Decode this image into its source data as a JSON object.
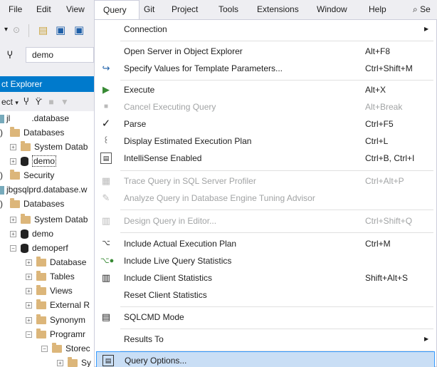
{
  "menubar": {
    "items": [
      "File",
      "Edit",
      "View",
      "Query",
      "Git",
      "Project",
      "Tools",
      "Extensions",
      "Window",
      "Help"
    ],
    "search_label": "Se"
  },
  "toolbar": {
    "database": "demo"
  },
  "object_explorer": {
    "title": "ct Explorer",
    "toolbar_label": "ect",
    "tree": [
      {
        "text": "jl",
        "suffix": ".database"
      },
      {
        "text": "Databases"
      },
      {
        "text": "System Datab"
      },
      {
        "text": "demo"
      },
      {
        "text": "Security"
      },
      {
        "text": "jbgsqlprd.database.w"
      },
      {
        "text": "Databases"
      },
      {
        "text": "System Datab"
      },
      {
        "text": "demo"
      },
      {
        "text": "demoperf"
      },
      {
        "text": "Database"
      },
      {
        "text": "Tables"
      },
      {
        "text": "Views"
      },
      {
        "text": "External R"
      },
      {
        "text": "Synonym"
      },
      {
        "text": "Programr"
      },
      {
        "text": "Storec"
      },
      {
        "text": "Sy"
      }
    ]
  },
  "query_menu": {
    "items": [
      {
        "label": "Connection",
        "shortcut": "",
        "submenu": true
      },
      {
        "label": "Open Server in Object Explorer",
        "shortcut": "Alt+F8"
      },
      {
        "label": "Specify Values for Template Parameters...",
        "shortcut": "Ctrl+Shift+M"
      },
      {
        "label": "Execute",
        "shortcut": "Alt+X"
      },
      {
        "label": "Cancel Executing Query",
        "shortcut": "Alt+Break"
      },
      {
        "label": "Parse",
        "shortcut": "Ctrl+F5"
      },
      {
        "label": "Display Estimated Execution Plan",
        "shortcut": "Ctrl+L"
      },
      {
        "label": "IntelliSense Enabled",
        "shortcut": "Ctrl+B, Ctrl+I"
      },
      {
        "label": "Trace Query in SQL Server Profiler",
        "shortcut": "Ctrl+Alt+P"
      },
      {
        "label": "Analyze Query in Database Engine Tuning Advisor",
        "shortcut": ""
      },
      {
        "label": "Design Query in Editor...",
        "shortcut": "Ctrl+Shift+Q"
      },
      {
        "label": "Include Actual Execution Plan",
        "shortcut": "Ctrl+M"
      },
      {
        "label": "Include Live Query Statistics",
        "shortcut": ""
      },
      {
        "label": "Include Client Statistics",
        "shortcut": "Shift+Alt+S"
      },
      {
        "label": "Reset Client Statistics",
        "shortcut": ""
      },
      {
        "label": "SQLCMD Mode",
        "shortcut": ""
      },
      {
        "label": "Results To",
        "shortcut": "",
        "submenu": true
      },
      {
        "label": "Query Options...",
        "shortcut": ""
      }
    ]
  },
  "colors": {
    "accent": "#007acc",
    "selection": "#c9def5",
    "disabled": "#a2a4a5"
  }
}
